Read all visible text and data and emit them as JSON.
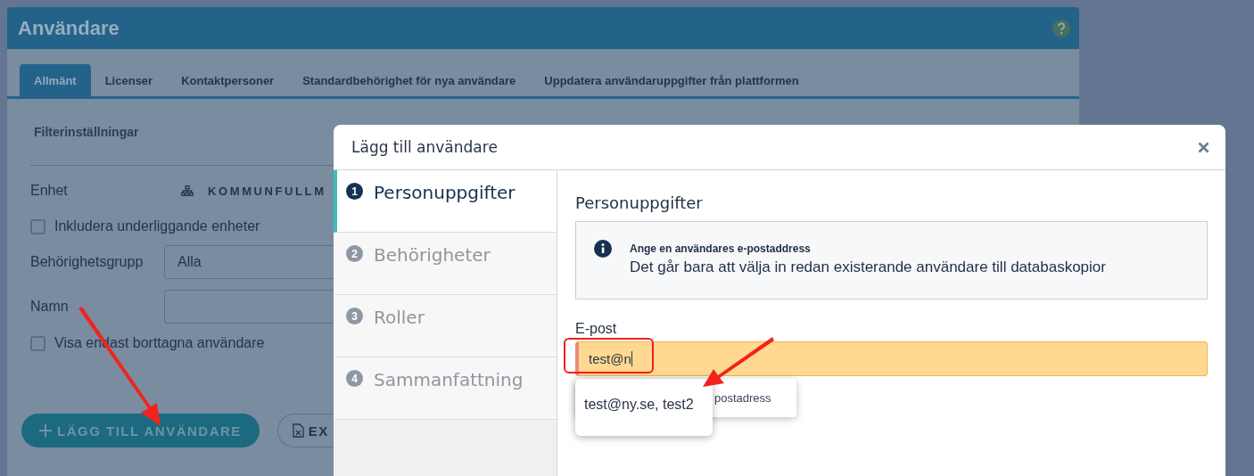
{
  "page": {
    "title": "Användare",
    "tabs": [
      {
        "label": "Allmänt",
        "selected": true
      },
      {
        "label": "Licenser",
        "selected": false
      },
      {
        "label": "Kontaktpersoner",
        "selected": false
      },
      {
        "label": "Standardbehörighet för nya användare",
        "selected": false
      },
      {
        "label": "Uppdatera användaruppgifter från plattformen",
        "selected": false
      }
    ],
    "filter": {
      "heading": "Filterinställningar",
      "unit_label": "Enhet",
      "unit_value": "KOMMUNFULLM",
      "include_subunits": {
        "label": "Inkludera underliggande enheter",
        "checked": false
      },
      "group_label": "Behörighetsgrupp",
      "group_value": "Alla",
      "name_label": "Namn",
      "deleted_only": {
        "label": "Visa endast borttagna användare",
        "checked": false
      }
    },
    "buttons": [
      {
        "label": "LÄGG TILL ANVÄNDARE",
        "kind": "add"
      },
      {
        "label": "EX",
        "kind": "export"
      }
    ]
  },
  "dialog": {
    "title": "Lägg till användare",
    "steps": [
      {
        "number": "1",
        "label": "Personuppgifter",
        "selected": true
      },
      {
        "number": "2",
        "label": "Behörigheter",
        "selected": false
      },
      {
        "number": "3",
        "label": "Roller",
        "selected": false
      },
      {
        "number": "4",
        "label": "Sammanfattning",
        "selected": false
      }
    ],
    "section_title": "Personuppgifter",
    "info": {
      "title": "Ange en användares e-postaddress",
      "text": "Det går bara att välja in redan existerande användare till databaskopior"
    },
    "email": {
      "label": "E-post",
      "value": "test@n",
      "hint": "postadress"
    },
    "suggestions": [
      "test@ny.se, test2"
    ]
  }
}
